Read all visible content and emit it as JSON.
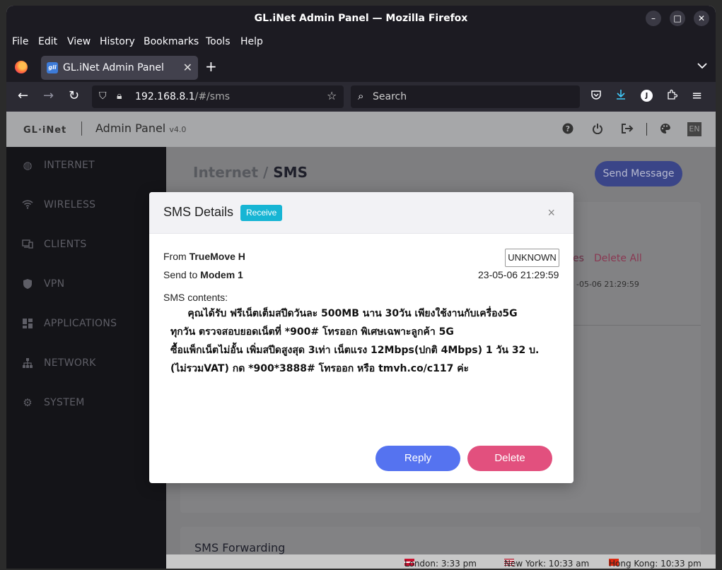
{
  "window": {
    "title": "GL.iNet Admin Panel — Mozilla Firefox"
  },
  "menu": [
    "File",
    "Edit",
    "View",
    "History",
    "Bookmarks",
    "Tools",
    "Help"
  ],
  "tab": {
    "title": "GL.iNet Admin Panel",
    "favicon": "gli"
  },
  "address": {
    "host": "192.168.8.1",
    "path": "/#/sms"
  },
  "search": {
    "placeholder": "Search"
  },
  "profile_initial": "J",
  "app": {
    "logo": "GL·iNet",
    "panel_title": "Admin Panel",
    "version": "v4.0",
    "lang": "EN"
  },
  "sidebar": [
    {
      "label": "INTERNET",
      "icon": "globe-icon"
    },
    {
      "label": "WIRELESS",
      "icon": "wifi-icon"
    },
    {
      "label": "CLIENTS",
      "icon": "devices-icon"
    },
    {
      "label": "VPN",
      "icon": "shield-icon",
      "chevron": true
    },
    {
      "label": "APPLICATIONS",
      "icon": "grid-icon",
      "chevron": true
    },
    {
      "label": "NETWORK",
      "icon": "network-icon",
      "chevron": true
    },
    {
      "label": "SYSTEM",
      "icon": "gear-icon",
      "chevron": true
    }
  ],
  "main": {
    "breadcrumb_parent": "Internet",
    "breadcrumb_sep": "/",
    "breadcrumb_current": "SMS",
    "send_message": "Send Message",
    "bg_delete_all": "Delete All",
    "bg_partial": "es",
    "bg_time": "-05-06 21:29:59",
    "forwarding_title": "SMS Forwarding"
  },
  "statusbar": {
    "close": "×",
    "london": "London: 3:33 pm",
    "newyork": "New York: 10:33 am",
    "hongkong": "Hong Kong: 10:33 pm"
  },
  "modal": {
    "title": "SMS Details",
    "badge": "Receive",
    "close": "×",
    "from_label": "From",
    "from_value": "TrueMove H",
    "to_label": "Send to",
    "to_value": "Modem 1",
    "status": "UNKNOWN",
    "time": "23-05-06 21:29:59",
    "contents_label": "SMS contents:",
    "contents": "     คุณได้รับ ฟรีเน็ตเต็มสปีดวันละ 500MB นาน 30วัน เพียงใช้งานกับเครื่อง5G\nทุกวัน ตรวจสอบยอดเน็ตที่ *900# โทรออก พิเศษเฉพาะลูกค้า 5G\nซื้อแพ็กเน็ตไม่อั้น เพิ่มสปีดสูงสุด 3เท่า เน็ตแรง 12Mbps(ปกติ 4Mbps) 1 วัน 32 บ.\n(ไม่รวมVAT) กด *900*3888# โทรออก หรือ tmvh.co/c117 ค่ะ",
    "reply": "Reply",
    "delete": "Delete"
  }
}
